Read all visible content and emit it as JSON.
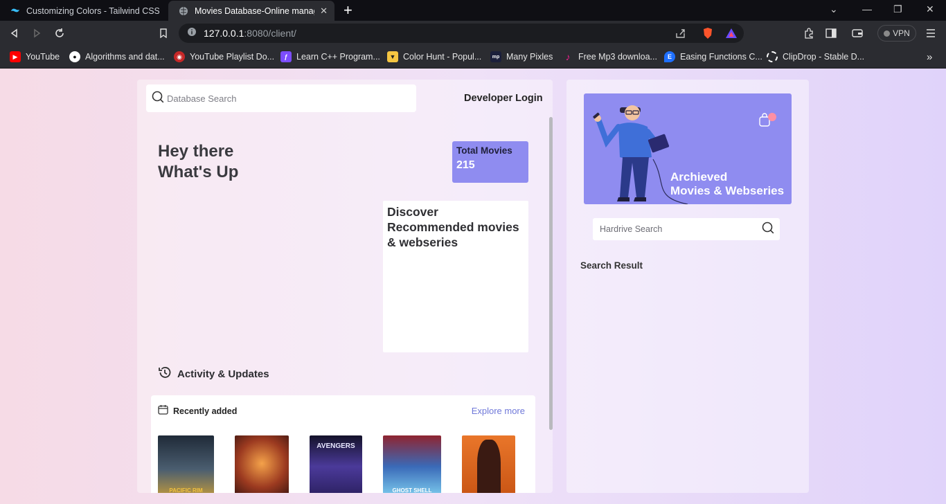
{
  "browser": {
    "tabs": [
      {
        "title": "Customizing Colors - Tailwind CSS",
        "favicon": "tailwind-icon",
        "active": false
      },
      {
        "title": "Movies Database-Online manage",
        "favicon": "globe-icon",
        "active": true
      }
    ],
    "new_tab_label": "+",
    "url": {
      "host": "127.0.0.1",
      "rest": ":8080/client/"
    },
    "vpn_label": "VPN",
    "bookmarks": [
      {
        "label": "YouTube",
        "icon": "youtube-icon",
        "color": "#ff0000"
      },
      {
        "label": "Algorithms and dat...",
        "icon": "github-icon",
        "color": "#ffffff"
      },
      {
        "label": "YouTube Playlist Do...",
        "icon": "playlist-icon",
        "color": "#c62828"
      },
      {
        "label": "Learn C++ Program...",
        "icon": "learn-cpp-icon",
        "color": "#7c4dff"
      },
      {
        "label": "Color Hunt - Popul...",
        "icon": "colorhunt-icon",
        "color": "#f5c542"
      },
      {
        "label": "Many Pixles",
        "icon": "manypixels-icon",
        "color": "#1b1f3b"
      },
      {
        "label": "Free Mp3 downloa...",
        "icon": "music-icon",
        "color": "#e91e8c"
      },
      {
        "label": "Easing Functions C...",
        "icon": "easing-icon",
        "color": "#1e6fff"
      },
      {
        "label": "ClipDrop - Stable D...",
        "icon": "clipdrop-icon",
        "color": "#ffffff"
      }
    ]
  },
  "header": {
    "search_placeholder": "Database Search",
    "developer_login": "Developer Login"
  },
  "hero": {
    "line1": "Hey there",
    "line2": "What's Up"
  },
  "stats": {
    "total_label": "Total Movies",
    "total_value": "215"
  },
  "discover": {
    "line1": "Discover",
    "line2": "Recommended movies",
    "line3": "& webseries"
  },
  "activity": {
    "title": "Activity & Updates"
  },
  "recent": {
    "title": "Recently added",
    "explore": "Explore more",
    "posters": [
      {
        "name": "pacific-rim-poster",
        "caption": "PACIFIC RIM",
        "bg": "#3a4a5a"
      },
      {
        "name": "avengers-infinity-war-poster",
        "caption": "",
        "bg": "#8a3a2a"
      },
      {
        "name": "avengers-endgame-poster",
        "caption": "AVENGERS",
        "bg": "#3a2d6e"
      },
      {
        "name": "ghost-in-the-shell-poster",
        "caption": "GHOST SHELL",
        "bg": "#2a5a9a"
      },
      {
        "name": "predator-poster",
        "caption": "",
        "bg": "#d9651e"
      }
    ]
  },
  "sidebar": {
    "banner_line1": "Archieved",
    "banner_line2": "Movies & Webseries",
    "hd_search_placeholder": "Hardrive Search",
    "search_result": "Search Result"
  },
  "colors": {
    "accent": "#8f8cf0",
    "link": "#6f78d9"
  }
}
